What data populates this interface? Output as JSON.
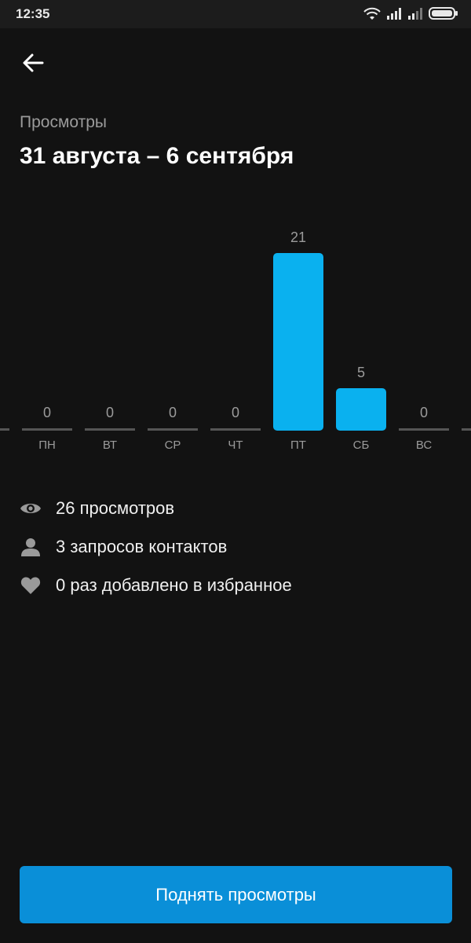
{
  "status_bar": {
    "time": "12:35",
    "icons": [
      "wifi-icon",
      "signal-icon",
      "signal-icon",
      "battery-icon"
    ]
  },
  "header": {
    "back_icon": "arrow-left-icon",
    "subtitle": "Просмотры",
    "title": "31 августа – 6 сентября"
  },
  "chart_data": {
    "type": "bar",
    "categories": [
      "ПН",
      "ВТ",
      "СР",
      "ЧТ",
      "ПТ",
      "СБ",
      "ВС"
    ],
    "values": [
      0,
      0,
      0,
      0,
      21,
      5,
      0
    ],
    "ylim": [
      0,
      21
    ],
    "bar_color": "#0ab1ef",
    "zero_color": "#555555",
    "grid": false
  },
  "stats": [
    {
      "icon": "eye-icon",
      "text": "26 просмотров"
    },
    {
      "icon": "person-icon",
      "text": "3 запросов контактов"
    },
    {
      "icon": "heart-icon",
      "text": "0 раз добавлено в избранное"
    }
  ],
  "action": {
    "label": "Поднять просмотры",
    "color": "#0a8fd8"
  }
}
